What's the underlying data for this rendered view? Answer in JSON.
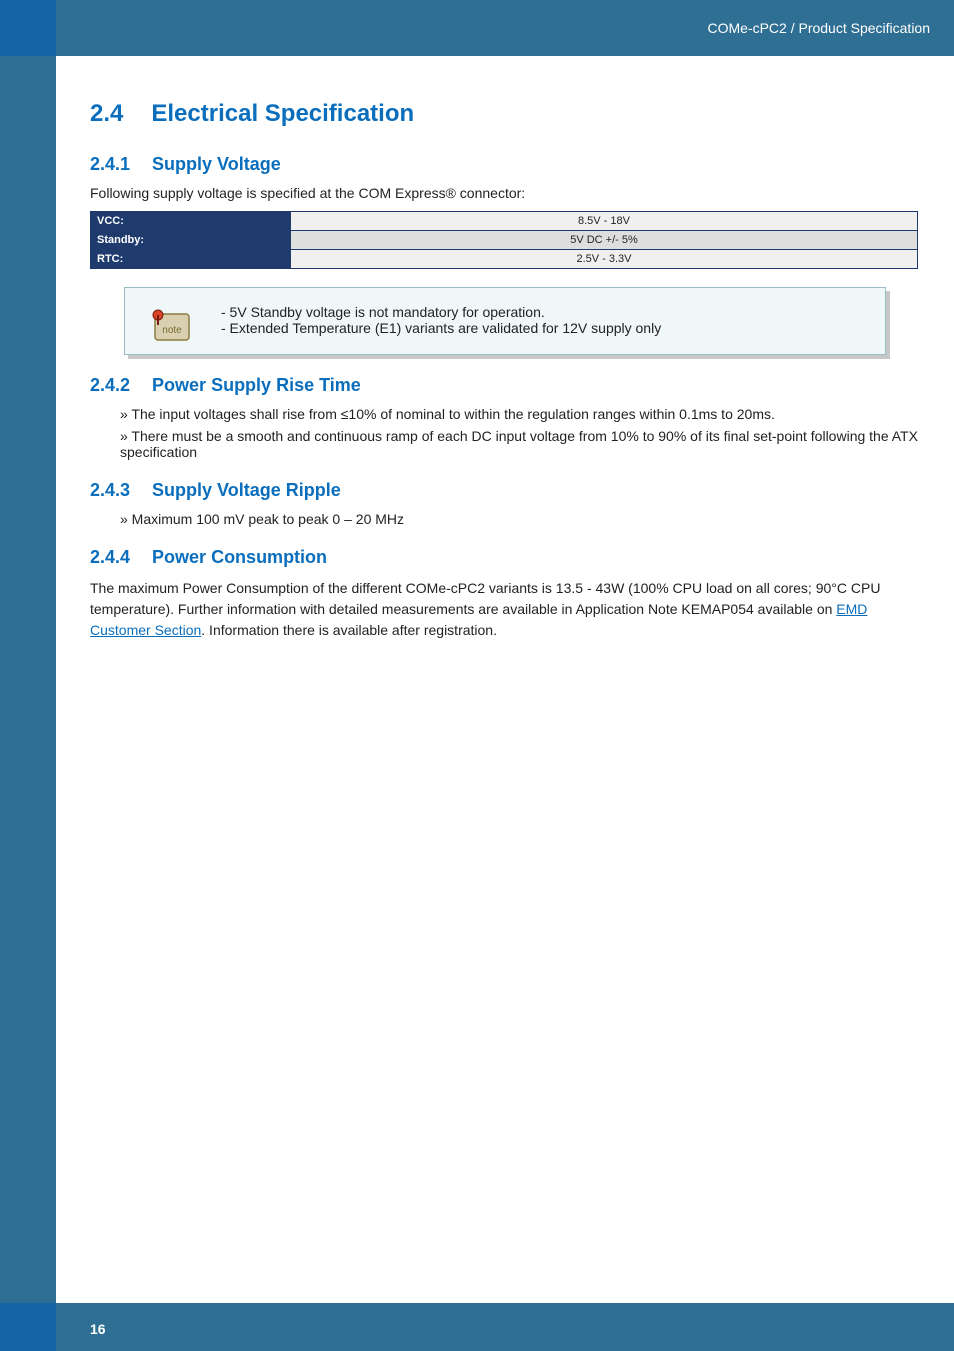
{
  "header": {
    "breadcrumb": "COMe-cPC2 / Product Specification"
  },
  "footer": {
    "page": "16"
  },
  "section": {
    "num": "2.4",
    "title": "Electrical Specification",
    "s1": {
      "num": "2.4.1",
      "title": "Supply Voltage",
      "lead": "Following supply voltage is specified at the COM Express® connector:",
      "rows": [
        {
          "label": "VCC:",
          "value": "8.5V - 18V"
        },
        {
          "label": "Standby:",
          "value": "5V DC +/- 5%"
        },
        {
          "label": "RTC:",
          "value": "2.5V - 3.3V"
        }
      ],
      "note": {
        "line1": "- 5V Standby voltage is not mandatory for operation.",
        "line2": "- Extended Temperature (E1) variants are validated for 12V supply only"
      }
    },
    "s2": {
      "num": "2.4.2",
      "title": "Power Supply Rise Time",
      "b1": "» The input voltages shall rise from ≤10% of nominal to within the regulation ranges within 0.1ms to 20ms.",
      "b2": "» There must be a smooth and continuous ramp of each DC input voltage from 10% to 90% of its final set-point following the ATX specification"
    },
    "s3": {
      "num": "2.4.3",
      "title": "Supply Voltage Ripple",
      "b1": "» Maximum 100 mV peak to peak 0 – 20 MHz"
    },
    "s4": {
      "num": "2.4.4",
      "title": "Power Consumption",
      "para_a": "The maximum Power Consumption of the different COMe-cPC2 variants is 13.5 - 43W (100% CPU load on all cores; 90°C CPU temperature). Further information with detailed measurements are available in Application Note KEMAP054 available on ",
      "link": "EMD Customer Section",
      "para_b": ". Information there is available after registration."
    }
  }
}
